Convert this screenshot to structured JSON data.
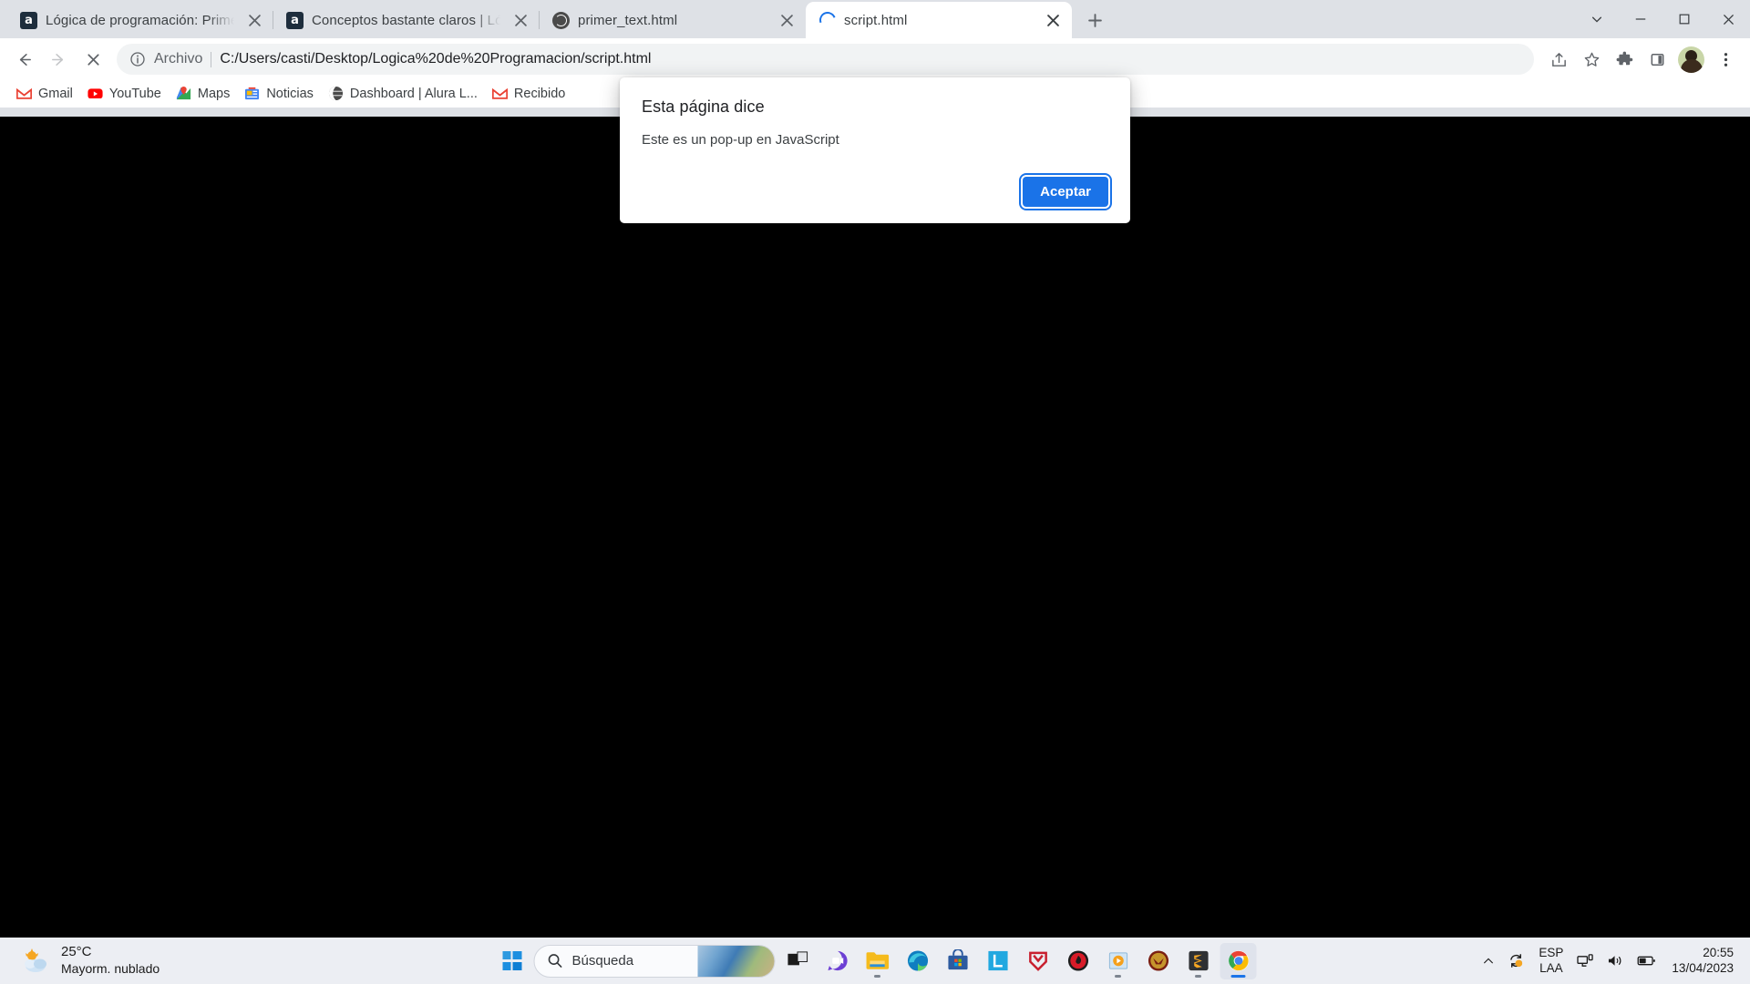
{
  "browser": {
    "tabs": [
      {
        "title": "Lógica de programación: Primeros",
        "favicon": "alura-icon",
        "active": false
      },
      {
        "title": "Conceptos bastante claros | Lógi",
        "favicon": "alura-icon",
        "active": false
      },
      {
        "title": "primer_text.html",
        "favicon": "globe-icon",
        "active": false
      },
      {
        "title": "script.html",
        "favicon": "loading-spinner-icon",
        "active": true
      }
    ],
    "new_tab_label": "+",
    "window_controls": {
      "minimize": "−",
      "maximize": "□",
      "close": "✕",
      "tab_search": "⌄"
    },
    "nav": {
      "back": "back-arrow-icon",
      "forward": "forward-arrow-icon",
      "stop": "stop-loading-icon"
    },
    "omnibox": {
      "scheme_label": "Archivo",
      "url": "C:/Users/casti/Desktop/Logica%20de%20Programacion/script.html",
      "info_icon": "info-circle-icon"
    },
    "toolbar_right": [
      "share-icon",
      "bookmark-star-icon",
      "extensions-puzzle-icon",
      "sidepanel-icon",
      "profile-avatar",
      "chrome-menu-icon"
    ],
    "bookmarks": [
      {
        "label": "Gmail",
        "icon": "gmail-icon"
      },
      {
        "label": "YouTube",
        "icon": "youtube-icon"
      },
      {
        "label": "Maps",
        "icon": "maps-icon"
      },
      {
        "label": "Noticias",
        "icon": "news-icon"
      },
      {
        "label": "Dashboard | Alura L...",
        "icon": "globe-dark-icon"
      },
      {
        "label": "Recibido",
        "icon": "gmail-icon"
      }
    ]
  },
  "dialog": {
    "title": "Esta página dice",
    "message": "Este es un pop-up en JavaScript",
    "accept_label": "Aceptar"
  },
  "taskbar": {
    "weather": {
      "temp": "25°C",
      "description": "Mayorm. nublado",
      "icon": "partly-cloudy-icon"
    },
    "start_label": "start-icon",
    "search": {
      "placeholder": "Búsqueda",
      "icon": "search-icon"
    },
    "apps": [
      {
        "name": "task-view",
        "running": false
      },
      {
        "name": "chat",
        "running": false
      },
      {
        "name": "file-explorer",
        "running": true
      },
      {
        "name": "microsoft-edge",
        "running": false
      },
      {
        "name": "microsoft-store",
        "running": false
      },
      {
        "name": "lenovo-app",
        "running": false
      },
      {
        "name": "mcafee",
        "running": false
      },
      {
        "name": "gaming-app",
        "running": false
      },
      {
        "name": "media-player",
        "running": true
      },
      {
        "name": "crossfire",
        "running": false
      },
      {
        "name": "sublime-text",
        "running": true
      },
      {
        "name": "google-chrome",
        "running": true,
        "active": true
      }
    ],
    "tray": {
      "overflow": "chevron-up-icon",
      "sync": "sync-status-icon",
      "language": {
        "line1": "ESP",
        "line2": "LAA"
      },
      "network": "network-icon",
      "volume": "volume-icon",
      "battery": "battery-icon",
      "time": "20:55",
      "date": "13/04/2023"
    }
  },
  "colors": {
    "accent": "#1a73e8",
    "tabstrip_bg": "#dee1e6",
    "toolbar_bg": "#ffffff",
    "page_bg": "#000000",
    "taskbar_bg": "#eceef3"
  }
}
